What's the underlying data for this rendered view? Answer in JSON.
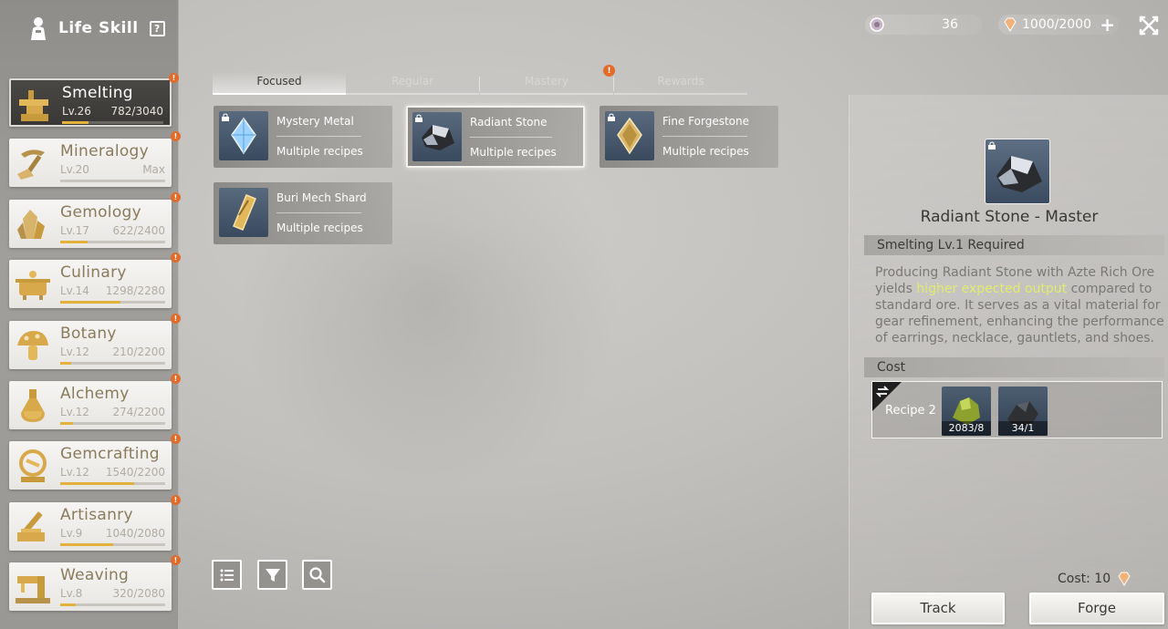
{
  "app": {
    "title": "Life Skill",
    "help_label": "?"
  },
  "resources": {
    "coins": "36",
    "gems": "1000/2000",
    "plus_label": "+"
  },
  "skills": [
    {
      "name": "Smelting",
      "level": "Lv.26",
      "xp": "782/3040",
      "progress": 0.26,
      "active": true
    },
    {
      "name": "Mineralogy",
      "level": "Lv.20",
      "xp": "Max",
      "progress": 0.0
    },
    {
      "name": "Gemology",
      "level": "Lv.17",
      "xp": "622/2400",
      "progress": 0.26
    },
    {
      "name": "Culinary",
      "level": "Lv.14",
      "xp": "1298/2280",
      "progress": 0.57
    },
    {
      "name": "Botany",
      "level": "Lv.12",
      "xp": "210/2200",
      "progress": 0.1
    },
    {
      "name": "Alchemy",
      "level": "Lv.12",
      "xp": "274/2200",
      "progress": 0.12
    },
    {
      "name": "Gemcrafting",
      "level": "Lv.12",
      "xp": "1540/2200",
      "progress": 0.7
    },
    {
      "name": "Artisanry",
      "level": "Lv.9",
      "xp": "1040/2080",
      "progress": 0.5
    },
    {
      "name": "Weaving",
      "level": "Lv.8",
      "xp": "320/2080",
      "progress": 0.15
    }
  ],
  "tabs": [
    {
      "label": "Focused"
    },
    {
      "label": "Regular"
    },
    {
      "label": "Mastery"
    },
    {
      "label": "Rewards"
    }
  ],
  "recipes": [
    {
      "name": "Mystery Metal",
      "sub": "Multiple recipes"
    },
    {
      "name": "Radiant Stone",
      "sub": "Multiple recipes"
    },
    {
      "name": "Fine Forgestone",
      "sub": "Multiple recipes"
    },
    {
      "name": "Buri Mech Shard",
      "sub": "Multiple recipes"
    }
  ],
  "detail": {
    "title": "Radiant Stone - Master",
    "requirement": "Smelting Lv.1 Required",
    "desc_pre": "Producing Radiant Stone with Azte Rich Ore yields ",
    "desc_highlight": "higher expected output",
    "desc_post": " compared to standard ore. It serves as a vital material for gear refinement, enhancing the performance of earrings, necklace, gauntlets, and shoes.",
    "cost_header": "Cost",
    "recipe_label": "Recipe 2",
    "materials": [
      {
        "count": "2083/8"
      },
      {
        "count": "34/1"
      }
    ],
    "cost_text": "Cost: 10",
    "track_label": "Track",
    "forge_label": "Forge"
  },
  "colors": {
    "accent_gold": "#e3b23c",
    "highlight_text": "#e0ec6c",
    "notification": "#e36b2a"
  }
}
